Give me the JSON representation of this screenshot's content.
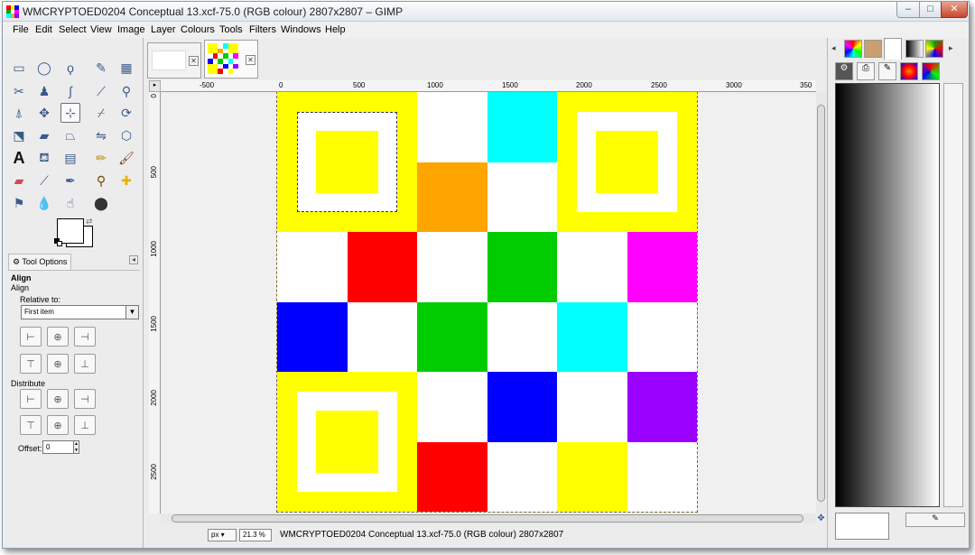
{
  "window": {
    "title": "WMCRYPTOED0204 Conceptual 13.xcf-75.0 (RGB colour) 2807x2807 – GIMP",
    "controls": {
      "minimize": "–",
      "maximize": "□",
      "close": "✕"
    }
  },
  "menubar": {
    "items": [
      "File",
      "Edit",
      "Select",
      "View",
      "Image",
      "Layer",
      "Colours",
      "Tools",
      "Filters",
      "Windows",
      "Help"
    ]
  },
  "toolbox": {
    "tools": [
      "rect-select",
      "ellipse-select",
      "free-select",
      "fuzzy-select",
      "zoom",
      "scissors",
      "foreground-select",
      "paths",
      "color-picker",
      "zoom-lens",
      "crop",
      "move",
      "align",
      "transform",
      "warp",
      "perspective",
      "flip",
      "cage",
      "text-bucket",
      "clone",
      "text",
      "bucket-fill",
      "blend",
      "pencil",
      "paintbrush",
      "eraser",
      "airbrush",
      "ink",
      "heal",
      "clone-stamp",
      "perspective-clone",
      "blur",
      "smudge",
      "dodge"
    ],
    "active_tool": "align"
  },
  "tool_options": {
    "tab_label": "Tool Options",
    "heading": "Align",
    "subheading": "Align",
    "relative_to_label": "Relative to:",
    "relative_to_value": "First item",
    "distribute_label": "Distribute",
    "offset_label": "Offset:",
    "offset_value": "0"
  },
  "image_tabs": [
    {
      "name": "blank-image"
    },
    {
      "name": "checker-image",
      "active": true
    }
  ],
  "rulers": {
    "horizontal": [
      "-500",
      "0",
      "500",
      "1000",
      "1500",
      "2000",
      "2500",
      "3000",
      "350"
    ],
    "vertical": [
      "0",
      "500",
      "1000",
      "1500",
      "2000",
      "2500"
    ]
  },
  "canvas": {
    "grid_colors": [
      [
        "#ffff00",
        "#ffff00",
        "#ffffff",
        "#00ffff",
        "#ffff00",
        "#ffff00"
      ],
      [
        "#ffff00",
        "#ffff00",
        "#ffa500",
        "#ffffff",
        "#ffff00",
        "#ffff00"
      ],
      [
        "#ffffff",
        "#ff0000",
        "#ffffff",
        "#00cc00",
        "#ffffff",
        "#ff00ff"
      ],
      [
        "#0000ff",
        "#ffffff",
        "#00cc00",
        "#ffffff",
        "#00ffff",
        "#ffffff"
      ],
      [
        "#ffff00",
        "#ffff00",
        "#ffffff",
        "#0000ff",
        "#ffffff",
        "#9900ff"
      ],
      [
        "#ffff00",
        "#ffff00",
        "#ff0000",
        "#ffffff",
        "#ffff00",
        "#ffffff"
      ]
    ],
    "square_icon_color": "#ffff00"
  },
  "statusbar": {
    "unit": "px",
    "zoom": "21.3 %",
    "text": "WMCRYPTOED0204 Conceptual 13.xcf-75.0 (RGB colour) 2807x2807"
  },
  "dock": {
    "tabs": [
      "brushes",
      "patterns",
      "fonts",
      "gradients",
      "palettes"
    ],
    "subtabs": [
      "tool-options",
      "device-status",
      "brushes-small",
      "palette-small",
      "colours-small"
    ]
  }
}
